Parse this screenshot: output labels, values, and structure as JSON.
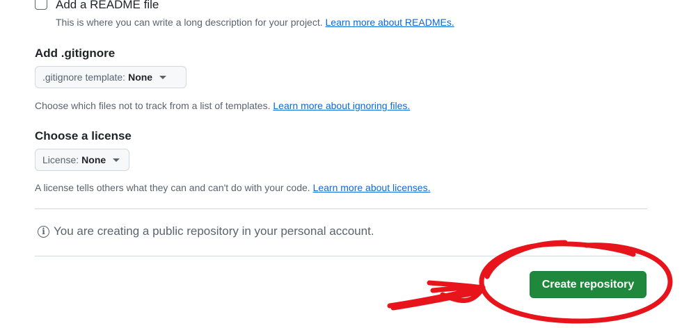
{
  "readme": {
    "label": "Add a README file",
    "description": "This is where you can write a long description for your project.",
    "link": "Learn more about READMEs."
  },
  "gitignore": {
    "title": "Add .gitignore",
    "select_label": ".gitignore template:",
    "select_value": "None",
    "help": "Choose which files not to track from a list of templates.",
    "link": "Learn more about ignoring files."
  },
  "license": {
    "title": "Choose a license",
    "select_label": "License:",
    "select_value": "None",
    "help": "A license tells others what they can and can't do with your code.",
    "link": "Learn more about licenses."
  },
  "notice": {
    "text": "You are creating a public repository in your personal account.",
    "icon": "info-icon"
  },
  "create_button": {
    "label": "Create repository"
  },
  "colors": {
    "primary_button": "#1f883d",
    "link": "#0969da",
    "annotation": "#e8141b"
  }
}
